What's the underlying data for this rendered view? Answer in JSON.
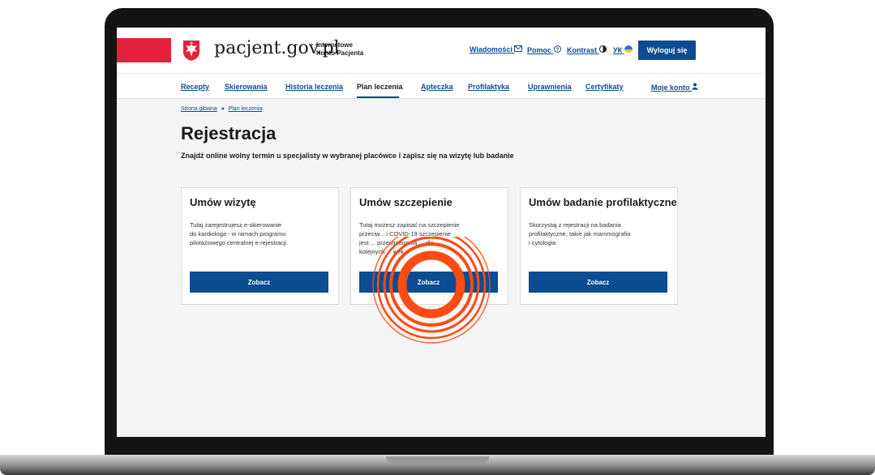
{
  "header": {
    "brand": "pacjent.gov.pl",
    "brand_sub_line1": "Internetowe",
    "brand_sub_line2": "Konto Pacjenta",
    "links": {
      "messages": "Wiadomości",
      "help": "Pomoc",
      "contrast": "Kontrast",
      "lang": "УК"
    },
    "logout": "Wyloguj się"
  },
  "nav": {
    "recepty": "Recepty",
    "skierowania": "Skierowania",
    "historia": "Historia leczenia",
    "plan": "Plan leczenia",
    "apteczka": "Apteczka",
    "profilaktyka": "Profilaktyka",
    "uprawnienia": "Uprawnienia",
    "certyfikaty": "Certyfikaty",
    "konto": "Moje konto"
  },
  "breadcrumb": {
    "home": "Strona główna",
    "sep": "»",
    "current": "Plan leczenia"
  },
  "page": {
    "title": "Rejestracja",
    "subtitle": "Znajdź online wolny termin u specjalisty w wybranej placówce i zapisz się na wizytę lub badanie"
  },
  "cards": [
    {
      "title": "Umów wizytę",
      "line1": "Tutaj zarejestrujesz e-skierowanie",
      "line2": "do kardiologa - w ramach programu",
      "line3": "pilotażowego centralnej e-rejestracji",
      "line4": "",
      "button": "Zobacz"
    },
    {
      "title": "Umów szczepienie",
      "line1": "Tutaj możesz zapisać na szczepienie",
      "line2": "przeciw... i COVID-19 szczepienie",
      "line3": "jest ... przestrzegania ... dla",
      "line4": "kolejnych ... wek",
      "button": "Zobacz"
    },
    {
      "title": "Umów badanie profilaktyczne",
      "line1": "Skorzystaj z rejestracji na badania",
      "line2": "profilaktyczne, takie jak mammografia",
      "line3": "i cytologia",
      "line4": "",
      "button": "Zobacz"
    }
  ],
  "colors": {
    "primary": "#0b4c92",
    "flag_red": "#e4213b",
    "marker": "#ff4b14"
  }
}
